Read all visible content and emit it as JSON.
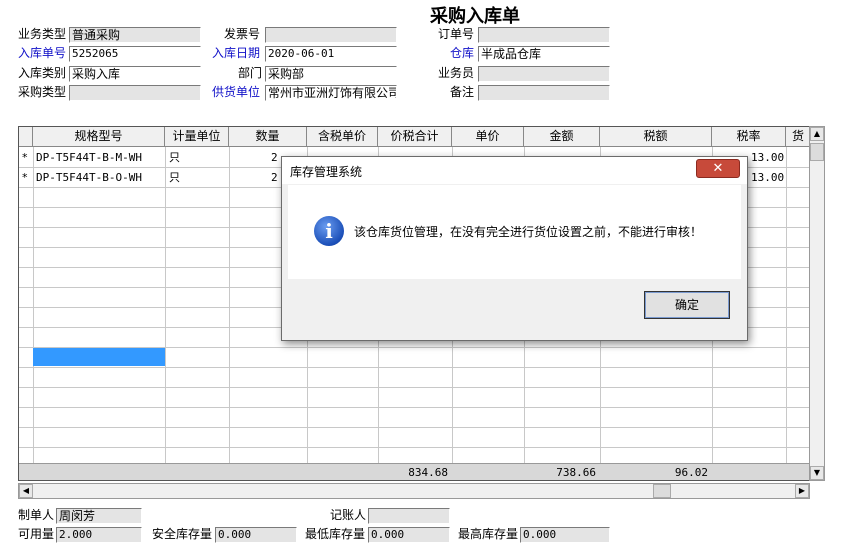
{
  "form": {
    "title": "采购入库单",
    "labels": {
      "biz_type": "业务类型",
      "invoice_no": "发票号",
      "order_no": "订单号",
      "doc_no": "入库单号",
      "doc_date": "入库日期",
      "warehouse": "仓库",
      "in_type": "入库类别",
      "dept": "部门",
      "clerk": "业务员",
      "purchase_type": "采购类型",
      "supplier": "供货单位",
      "remark": "备注"
    },
    "values": {
      "biz_type": "普通采购",
      "invoice_no": "",
      "order_no": "",
      "doc_no": "5252065",
      "doc_date": "2020-06-01",
      "warehouse": "半成品仓库",
      "in_type": "采购入库",
      "dept": "采购部",
      "clerk": "",
      "purchase_type": "",
      "supplier": "常州市亚洲灯饰有限公司",
      "remark": ""
    }
  },
  "grid": {
    "columns": [
      "规格型号",
      "计量单位",
      "数量",
      "含税单价",
      "价税合计",
      "单价",
      "金额",
      "税额",
      "税率",
      "货"
    ],
    "rows": [
      {
        "marker": "*",
        "spec": "DP-T5F44T-B-M-WH",
        "unit": "只",
        "qty": "2",
        "tax_rate": "13.00"
      },
      {
        "marker": "*",
        "spec": "DP-T5F44T-B-O-WH",
        "unit": "只",
        "qty": "2",
        "tax_rate": "13.00"
      }
    ],
    "totals": {
      "tax_total": "834.68",
      "amount": "738.66",
      "tax": "96.02"
    }
  },
  "footer": {
    "labels": {
      "maker": "制单人",
      "bookkeeper": "记账人",
      "available": "可用量",
      "safety_stock": "安全库存量",
      "min_stock": "最低库存量",
      "max_stock": "最高库存量"
    },
    "values": {
      "maker": "周闵芳",
      "bookkeeper": "",
      "available": "2.000",
      "safety_stock": "0.000",
      "min_stock": "0.000",
      "max_stock": "0.000"
    }
  },
  "dialog": {
    "title": "库存管理系统",
    "close": "✕",
    "icon": "info-icon",
    "icon_glyph": "i",
    "message": "该仓库货位管理，在没有完全进行货位设置之前，不能进行审核！",
    "ok_label": "确定"
  },
  "colors": {
    "label_blue": "#1010c8",
    "selection": "#3399ff",
    "close_red": "#c74a3a"
  }
}
